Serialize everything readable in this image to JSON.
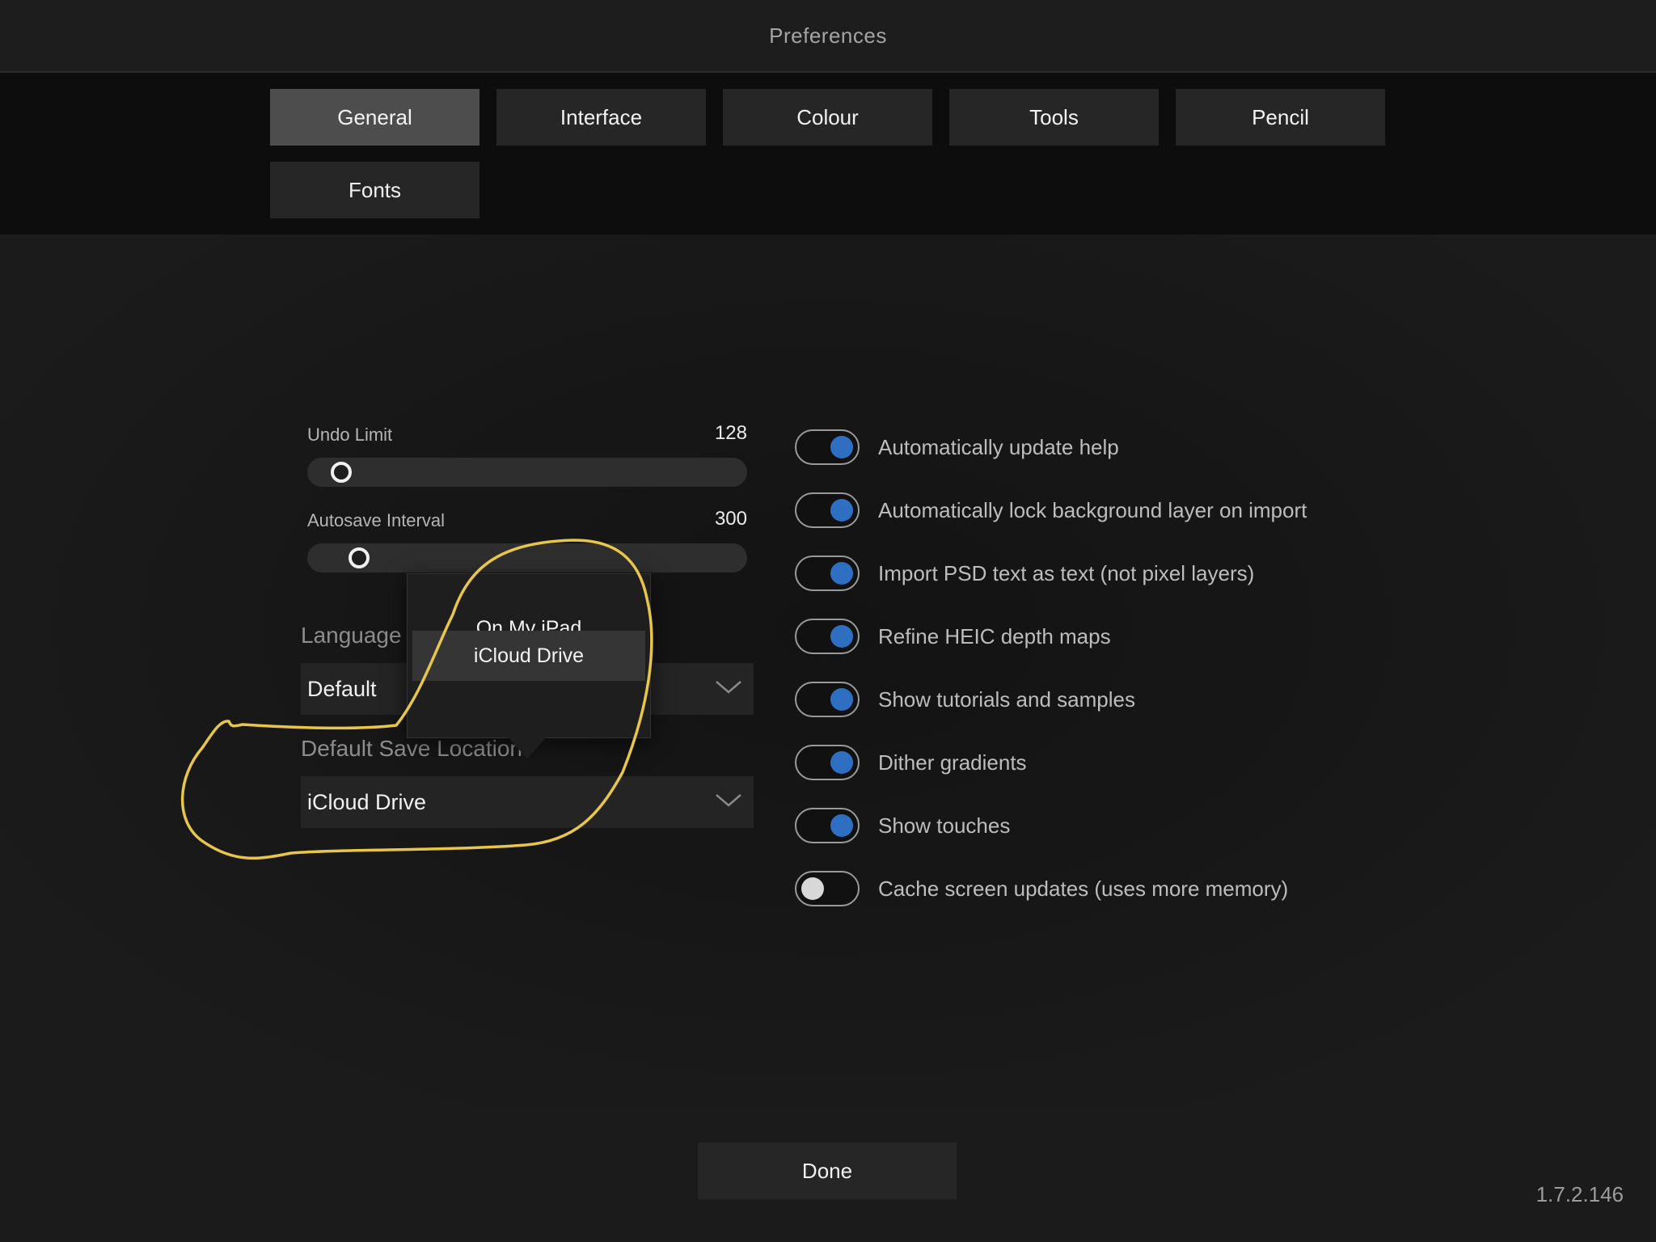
{
  "window": {
    "title": "Preferences"
  },
  "tabs": [
    {
      "label": "General",
      "active": true
    },
    {
      "label": "Interface",
      "active": false
    },
    {
      "label": "Colour",
      "active": false
    },
    {
      "label": "Tools",
      "active": false
    },
    {
      "label": "Pencil",
      "active": false
    },
    {
      "label": "Fonts",
      "active": false
    }
  ],
  "sliders": {
    "undo_limit": {
      "label": "Undo Limit",
      "value": "128"
    },
    "autosave_interval": {
      "label": "Autosave Interval",
      "value": "300"
    }
  },
  "language": {
    "label": "Language",
    "value": "Default"
  },
  "save_location": {
    "label": "Default Save Location",
    "value": "iCloud Drive"
  },
  "popover": {
    "options": [
      {
        "label": "On My iPad",
        "selected": false
      },
      {
        "label": "iCloud Drive",
        "selected": true
      }
    ]
  },
  "toggles": [
    {
      "label": "Automatically update help",
      "on": true
    },
    {
      "label": "Automatically lock background layer on import",
      "on": true
    },
    {
      "label": "Import PSD text as text (not pixel layers)",
      "on": true
    },
    {
      "label": "Refine HEIC depth maps",
      "on": true
    },
    {
      "label": "Show tutorials and samples",
      "on": true
    },
    {
      "label": "Dither gradients",
      "on": true
    },
    {
      "label": "Show touches",
      "on": true
    },
    {
      "label": "Cache screen updates (uses more memory)",
      "on": false
    }
  ],
  "footer": {
    "done_label": "Done",
    "version": "1.7.2.146"
  },
  "colors": {
    "toggle_on": "#2f6fc2",
    "annotation": "#e7c64a",
    "active_tab": "#4d4d4d"
  }
}
